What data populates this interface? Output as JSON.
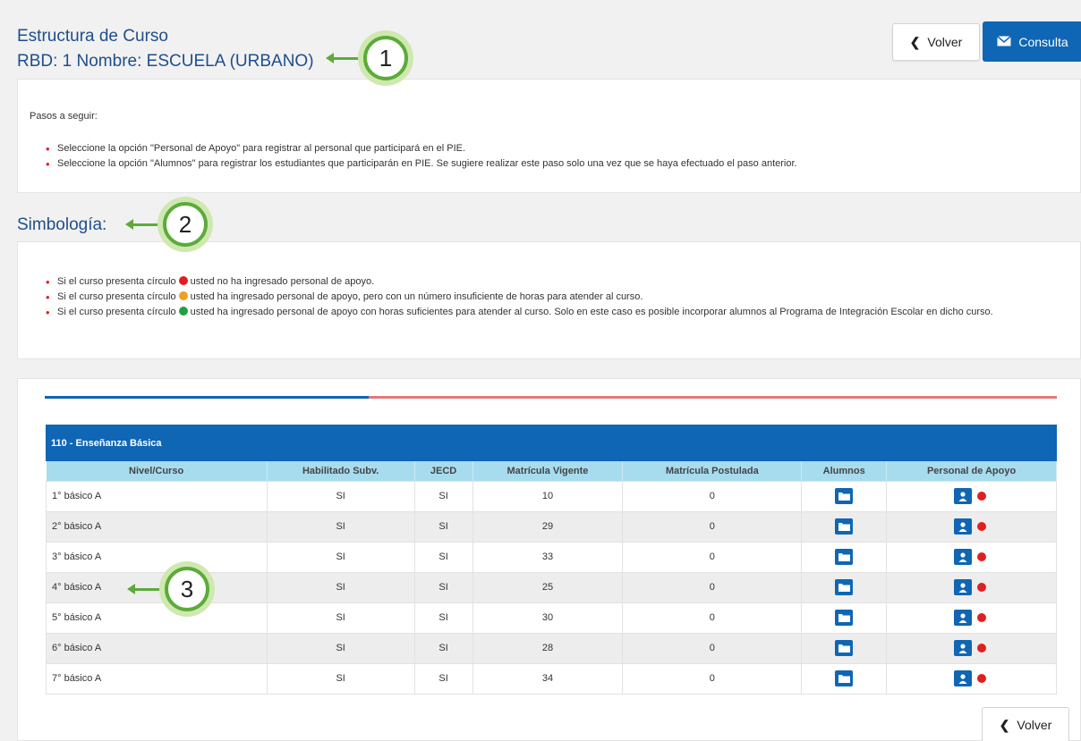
{
  "header": {
    "title": "Estructura de Curso",
    "subtitle": "RBD: 1 Nombre: ESCUELA (URBANO)",
    "volver_label": "Volver",
    "consulta_label": "Consulta"
  },
  "pasos": {
    "title": "Pasos a seguir:",
    "items": [
      "Seleccione la opción \"Personal de Apoyo\" para registrar al personal que participará en el PIE.",
      "Seleccione la opción \"Alumnos\" para registrar los estudiantes que participarán en PIE. Se sugiere realizar este paso solo una vez que se haya efectuado el paso anterior."
    ]
  },
  "simbologia": {
    "title": "Simbología:",
    "items": [
      {
        "pre": "Si el curso presenta círculo",
        "post": "usted no ha ingresado personal de apoyo.",
        "color": "#e02020"
      },
      {
        "pre": "Si el curso presenta círculo",
        "post": "usted ha ingresado personal de apoyo, pero con un número insuficiente de horas para atender al curso.",
        "color": "#f0a020"
      },
      {
        "pre": "Si el curso presenta círculo",
        "post": "usted ha ingresado personal de apoyo con horas suficientes para atender al curso. Solo en este caso es posible incorporar alumnos al Programa de Integración Escolar en dicho curso.",
        "color": "#20a040"
      }
    ]
  },
  "table": {
    "section_title": "110 - Enseñanza Básica",
    "columns": [
      "Nivel/Curso",
      "Habilitado Subv.",
      "JECD",
      "Matrícula Vigente",
      "Matrícula Postulada",
      "Alumnos",
      "Personal de Apoyo"
    ],
    "rows": [
      [
        "1° básico A",
        "SI",
        "SI",
        "10",
        "0"
      ],
      [
        "2° básico A",
        "SI",
        "SI",
        "29",
        "0"
      ],
      [
        "3° básico A",
        "SI",
        "SI",
        "33",
        "0"
      ],
      [
        "4° básico A",
        "SI",
        "SI",
        "25",
        "0"
      ],
      [
        "5° básico A",
        "SI",
        "SI",
        "30",
        "0"
      ],
      [
        "6° básico A",
        "SI",
        "SI",
        "28",
        "0"
      ],
      [
        "7° básico A",
        "SI",
        "SI",
        "34",
        "0"
      ]
    ],
    "status_color": "#e02020"
  },
  "footer": {
    "volver_label": "Volver"
  },
  "callouts": [
    "1",
    "2",
    "3"
  ],
  "colors": {
    "accent": "#0f66b4",
    "header_row": "#a7dcef",
    "callout_green": "#5cab3a"
  }
}
